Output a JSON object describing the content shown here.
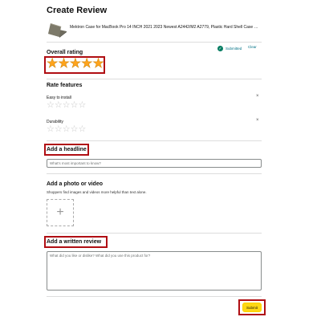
{
  "page": {
    "title": "Create Review"
  },
  "product": {
    "name": "Mektron Case for MacBook Pro 14 INCH 2021 2023 Newest A2442/M2 A2779, Plastic Hard Shell Case & Keyboard Cover"
  },
  "overall": {
    "label": "Overall rating",
    "status": "Submitted",
    "clear": "Clear",
    "rating": 5,
    "max": 5,
    "stars": "★★★★★"
  },
  "features": {
    "heading": "Rate features",
    "items": [
      {
        "label": "Easy to install",
        "stars": "☆☆☆☆☆",
        "remove": "×"
      },
      {
        "label": "Durability",
        "stars": "☆☆☆☆☆",
        "remove": "×"
      }
    ]
  },
  "headline": {
    "label": "Add a headline",
    "placeholder": "What's most important to know?"
  },
  "photo": {
    "label": "Add a photo or video",
    "description": "Shoppers find images and videos more helpful than text alone.",
    "plus": "+"
  },
  "review": {
    "label": "Add a written review",
    "placeholder": "What did you like or dislike? What did you use this product for?"
  },
  "submit": {
    "label": "Submit"
  },
  "colors": {
    "highlight": "#b00e13",
    "star": "#ffa41c",
    "submit": "#ffd814",
    "link": "#007185"
  }
}
